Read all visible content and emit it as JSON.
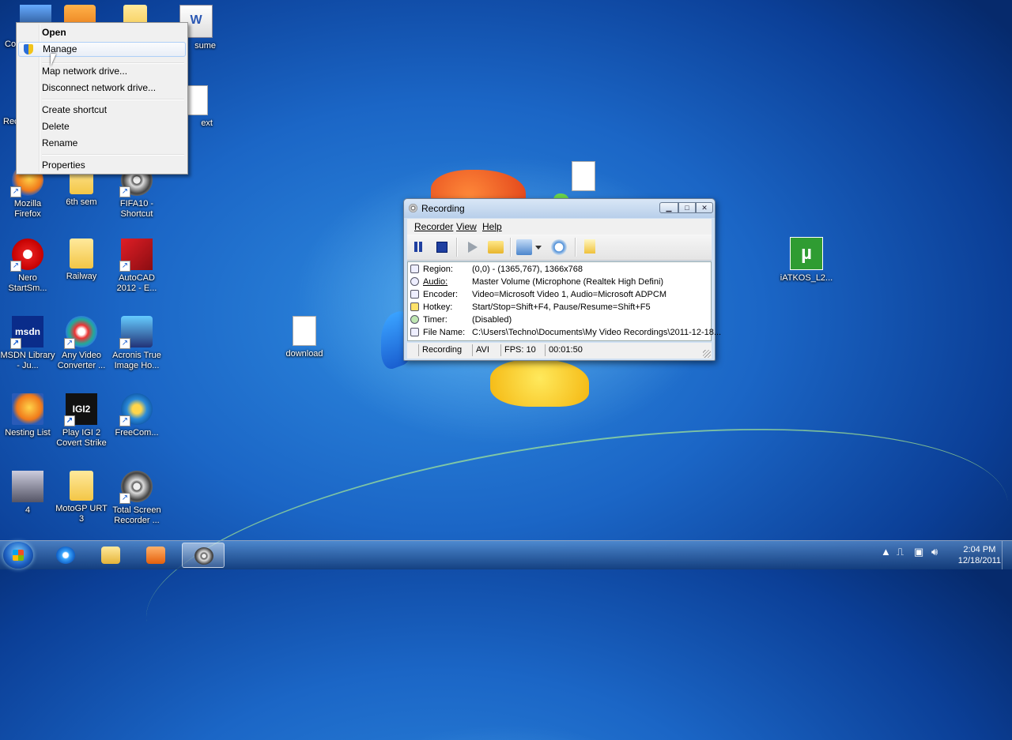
{
  "desktop_icons": [
    {
      "label": "Mozilla Firefox",
      "kind": "firefox"
    },
    {
      "label": "6th sem",
      "kind": "folder"
    },
    {
      "label": "FIFA10 - Shortcut",
      "kind": "reel"
    },
    {
      "label": "Nero StartSm...",
      "kind": "nero"
    },
    {
      "label": "Railway",
      "kind": "folder"
    },
    {
      "label": "AutoCAD 2012 - E...",
      "kind": "autocad"
    },
    {
      "label": "MSDN Library - Ju...",
      "kind": "msdn"
    },
    {
      "label": "Any Video Converter ...",
      "kind": "avc"
    },
    {
      "label": "Acronis True Image Ho...",
      "kind": "acronis"
    },
    {
      "label": "download",
      "kind": "doc"
    },
    {
      "label": "Nesting List",
      "kind": "firefox-doc"
    },
    {
      "label": "Play IGI 2 Covert Strike",
      "kind": "igi"
    },
    {
      "label": "FreeCom...",
      "kind": "freecom"
    },
    {
      "label": "4",
      "kind": "photo"
    },
    {
      "label": "MotoGP URT 3",
      "kind": "folder"
    },
    {
      "label": "Total Screen Recorder ...",
      "kind": "reel"
    },
    {
      "label": "iATKOS_L2...",
      "kind": "utorrent"
    },
    {
      "label": "sume",
      "kind": "word"
    },
    {
      "label": "ext",
      "kind": "doc"
    },
    {
      "label": "Co",
      "kind": "computer"
    },
    {
      "label": "Rec",
      "kind": "recycle"
    }
  ],
  "context_menu": {
    "items": [
      "Open",
      "Manage",
      "Map network drive...",
      "Disconnect network drive...",
      "Create shortcut",
      "Delete",
      "Rename",
      "Properties"
    ]
  },
  "recording_window": {
    "title": "Recording",
    "menu": [
      "Recorder",
      "View",
      "Help"
    ],
    "toolbar": [
      "pause",
      "stop",
      "play",
      "open-folder",
      "edit",
      "dropdown",
      "timer",
      "pointer"
    ],
    "info_rows": [
      {
        "key": "Region:",
        "value": "(0,0) - (1365,767), 1366x768"
      },
      {
        "key": "Audio:",
        "value": "Master Volume (Microphone (Realtek High Defini)"
      },
      {
        "key": "Encoder:",
        "value": "Video=Microsoft Video 1, Audio=Microsoft ADPCM"
      },
      {
        "key": "Hotkey:",
        "value": "Start/Stop=Shift+F4, Pause/Resume=Shift+F5"
      },
      {
        "key": "Timer:",
        "value": "(Disabled)"
      },
      {
        "key": "File Name:",
        "value": "C:\\Users\\Techno\\Documents\\My Video Recordings\\2011-12-18..."
      }
    ],
    "status": {
      "state": "Recording",
      "format": "AVI",
      "fps": "FPS: 10",
      "elapsed": "00:01:50"
    }
  },
  "taskbar": {
    "pinned": [
      "internet-explorer",
      "windows-explorer",
      "media-player",
      "screen-recorder"
    ],
    "clock": {
      "time": "2:04 PM",
      "date": "12/18/2011"
    }
  }
}
